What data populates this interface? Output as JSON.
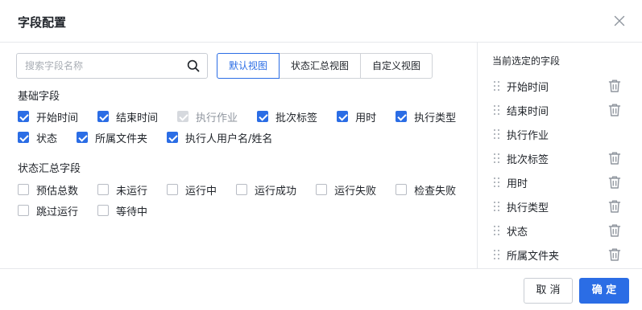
{
  "dialog": {
    "title": "字段配置",
    "close_icon": "close-icon"
  },
  "search": {
    "placeholder": "搜索字段名称",
    "value": "",
    "icon": "search-icon"
  },
  "view_tabs": [
    {
      "label": "默认视图",
      "active": true
    },
    {
      "label": "状态汇总视图",
      "active": false
    },
    {
      "label": "自定义视图",
      "active": false
    }
  ],
  "basic_fields": {
    "title": "基础字段",
    "items": [
      {
        "label": "开始时间",
        "checked": true,
        "disabled": false
      },
      {
        "label": "结束时间",
        "checked": true,
        "disabled": false
      },
      {
        "label": "执行作业",
        "checked": true,
        "disabled": true
      },
      {
        "label": "批次标签",
        "checked": true,
        "disabled": false
      },
      {
        "label": "用时",
        "checked": true,
        "disabled": false
      },
      {
        "label": "执行类型",
        "checked": true,
        "disabled": false
      },
      {
        "label": "状态",
        "checked": true,
        "disabled": false
      },
      {
        "label": "所属文件夹",
        "checked": true,
        "disabled": false
      },
      {
        "label": "执行人用户名/姓名",
        "checked": true,
        "disabled": false
      }
    ]
  },
  "status_fields": {
    "title": "状态汇总字段",
    "items": [
      {
        "label": "预估总数",
        "checked": false
      },
      {
        "label": "未运行",
        "checked": false
      },
      {
        "label": "运行中",
        "checked": false
      },
      {
        "label": "运行成功",
        "checked": false
      },
      {
        "label": "运行失败",
        "checked": false
      },
      {
        "label": "检查失败",
        "checked": false
      },
      {
        "label": "跳过运行",
        "checked": false
      },
      {
        "label": "等待中",
        "checked": false
      }
    ]
  },
  "selected": {
    "title": "当前选定的字段",
    "items": [
      {
        "label": "开始时间",
        "deletable": true
      },
      {
        "label": "结束时间",
        "deletable": true
      },
      {
        "label": "执行作业",
        "deletable": false
      },
      {
        "label": "批次标签",
        "deletable": true
      },
      {
        "label": "用时",
        "deletable": true
      },
      {
        "label": "执行类型",
        "deletable": true
      },
      {
        "label": "状态",
        "deletable": true
      },
      {
        "label": "所属文件夹",
        "deletable": true
      }
    ]
  },
  "footer": {
    "cancel_label": "取 消",
    "ok_label": "确 定"
  },
  "colors": {
    "accent": "#2b6de5",
    "disabled": "#d6d9de",
    "border": "#e6e8eb"
  }
}
